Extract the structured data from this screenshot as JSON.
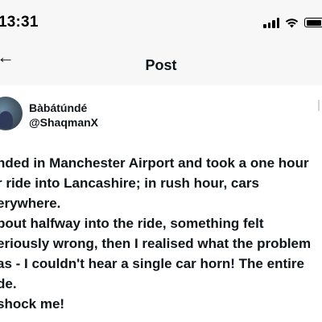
{
  "status_bar": {
    "time": "13:31",
    "icons": [
      "signal-icon",
      "wifi-icon",
      "battery-icon"
    ]
  },
  "header": {
    "title": "Post",
    "back_icon": "arrow-left-icon"
  },
  "post": {
    "author": {
      "display_name": "Bàbátúndé",
      "handle": "@ShaqmanX"
    },
    "lines": [
      "nded in Manchester Airport and took a one hour",
      "r ride into Lancashire; in rush hour, cars",
      "erywhere.",
      "bout halfway into the ride, something felt",
      "eriously wrong, then I realised what the problem",
      "as - I couldn't hear a single car horn! The entire",
      "de.",
      "shock me!"
    ]
  },
  "colors": {
    "text": "#0f1419",
    "bar_background": "#f7f7f8",
    "background": "#ffffff"
  }
}
